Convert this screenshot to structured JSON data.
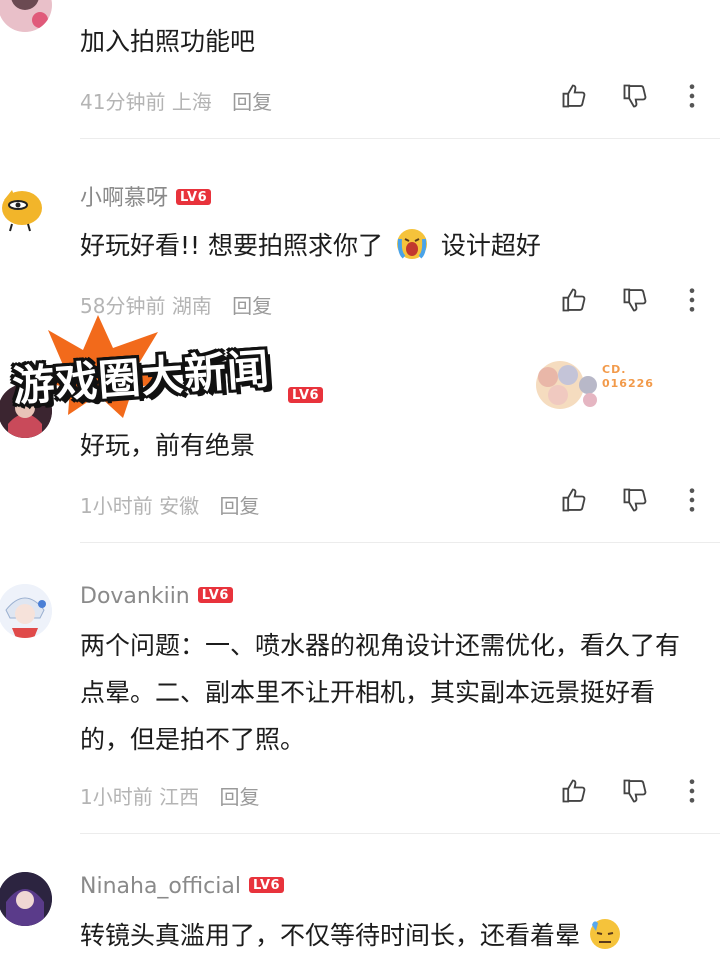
{
  "comments": [
    {
      "username": "",
      "level": "",
      "text": "加入拍照功能吧",
      "time": "41分钟前",
      "location": "上海",
      "reply": "回复"
    },
    {
      "username": "小啊慕呀",
      "level": "LV6",
      "text": "好玩好看!! 想要拍照求你了",
      "text_after_emoji": "设计超好",
      "time": "58分钟前",
      "location": "湖南",
      "reply": "回复"
    },
    {
      "username": "",
      "level": "LV6",
      "text": "好玩，前有绝景",
      "time": "1小时前",
      "location": "安徽",
      "reply": "回复"
    },
    {
      "username": "Dovankiin",
      "level": "LV6",
      "text": "两个问题：一、喷水器的视角设计还需优化，看久了有点晕。二、副本里不让开相机，其实副本远景挺好看的，但是拍不了照。",
      "time": "1小时前",
      "location": "江西",
      "reply": "回复"
    },
    {
      "username": "Ninaha_official",
      "level": "LV6",
      "text": "转镜头真滥用了，不仅等待时间长，还看着晕",
      "time": "",
      "location": "",
      "reply": ""
    }
  ],
  "watermark": {
    "banner": "游戏圈大新闻",
    "stamp_code": "CD.\n016226"
  },
  "colors": {
    "level_badge": "#e8333c",
    "banner_burst": "#f26a1b"
  },
  "icons": [
    "thumbs-up-icon",
    "thumbs-down-icon",
    "more-vertical-icon"
  ]
}
